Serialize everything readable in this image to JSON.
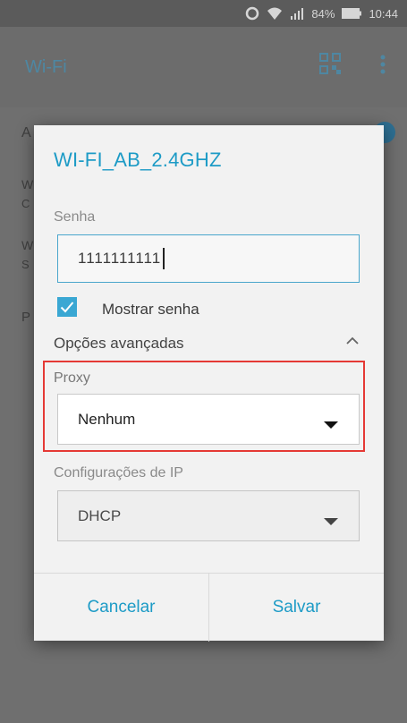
{
  "status_bar": {
    "battery_percent": "84%",
    "time": "10:44",
    "icons": [
      "sync-icon",
      "wifi-icon",
      "signal-icon",
      "battery-icon"
    ]
  },
  "app_bar": {
    "title": "Wi-Fi",
    "icons": [
      "qr-code-icon",
      "more-vert-icon"
    ]
  },
  "background_list": {
    "row_initials": [
      "A",
      "W",
      "W",
      "P"
    ],
    "row_subinitials": [
      "C",
      "S"
    ]
  },
  "dialog": {
    "title": "WI-FI_AB_2.4GHZ",
    "password_label": "Senha",
    "password_value": "1111111111",
    "show_password_label": "Mostrar senha",
    "show_password_checked": true,
    "advanced_label": "Opções avançadas",
    "proxy_label": "Proxy",
    "proxy_value": "Nenhum",
    "ip_label": "Configurações de IP",
    "ip_value": "DHCP",
    "cancel_label": "Cancelar",
    "save_label": "Salvar"
  },
  "colors": {
    "accent": "#1d9bc6",
    "highlight": "#e53935"
  }
}
